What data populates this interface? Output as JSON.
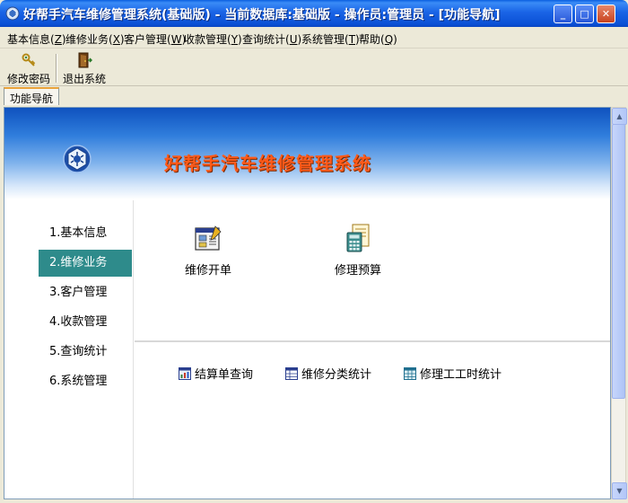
{
  "window": {
    "title": "好帮手汽车维修管理系统(基础版) - 当前数据库:基础版 - 操作员:管理员 - [功能导航]",
    "minimize_label": "_",
    "maximize_label": "□",
    "close_label": "✕"
  },
  "menu": {
    "items": [
      {
        "label": "基本信息(",
        "key": "Z",
        "end": ")"
      },
      {
        "label": "维修业务(",
        "key": "X",
        "end": ")"
      },
      {
        "label": "客户管理(",
        "key": "W",
        "end": ")"
      },
      {
        "label": "收款管理(",
        "key": "Y",
        "end": ")"
      },
      {
        "label": "查询统计(",
        "key": "U",
        "end": ")"
      },
      {
        "label": "系统管理(",
        "key": "T",
        "end": ")"
      },
      {
        "label": "帮助(",
        "key": "Q",
        "end": ")"
      }
    ]
  },
  "toolbar": {
    "change_password": "修改密码",
    "exit": "退出系统"
  },
  "tabs": {
    "nav": "功能导航"
  },
  "banner": {
    "title": "好帮手汽车维修管理系统"
  },
  "nav": {
    "items": [
      {
        "label": "1.基本信息",
        "active": false
      },
      {
        "label": "2.维修业务",
        "active": true
      },
      {
        "label": "3.客户管理",
        "active": false
      },
      {
        "label": "4.收款管理",
        "active": false
      },
      {
        "label": "5.查询统计",
        "active": false
      },
      {
        "label": "6.系统管理",
        "active": false
      }
    ]
  },
  "functions": {
    "repair_order": "维修开单",
    "repair_estimate": "修理预算",
    "settlement_query": "结算单查询",
    "repair_category_stats": "维修分类统计",
    "labor_hour_stats": "修理工工时统计"
  },
  "colors": {
    "active_nav": "#2e8b8b",
    "banner_title": "#ff5a1a",
    "titlebar": "#0a50d5"
  }
}
